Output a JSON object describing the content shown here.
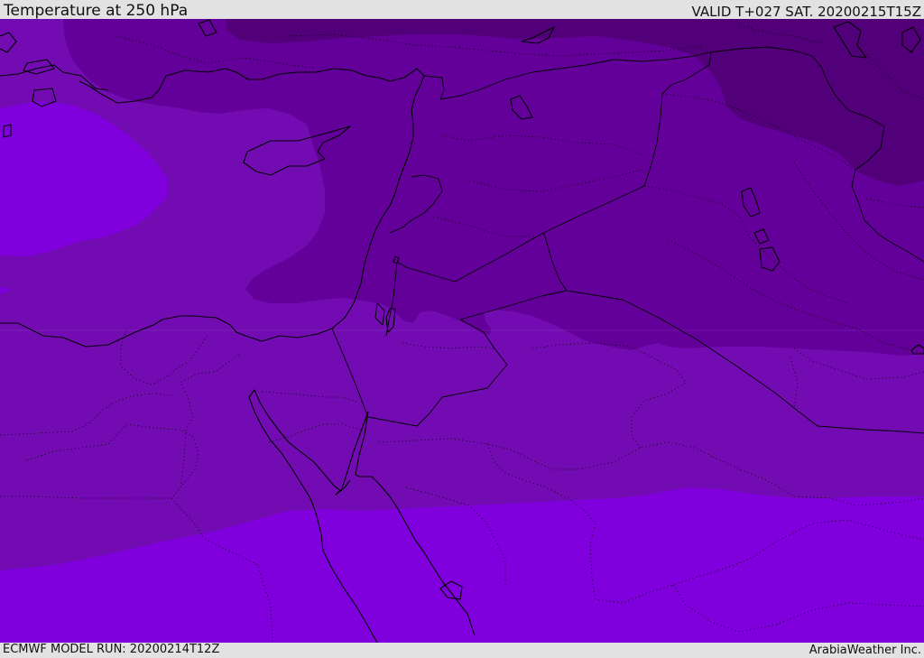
{
  "header": {
    "title": "Temperature at 250 hPa",
    "valid": "VALID T+027 SAT. 20200215T15Z"
  },
  "footer": {
    "model_run": "ECMWF MODEL RUN: 20200214T12Z",
    "credit": "ArabiaWeather Inc."
  },
  "map": {
    "parameter": "temperature",
    "level": "250 hPa",
    "colors": {
      "warmest_band": "#7f00dc",
      "band_2": "#720cb2",
      "band_3": "#63009a",
      "coldest_band": "#52007a",
      "boundaries": "#000000"
    }
  }
}
